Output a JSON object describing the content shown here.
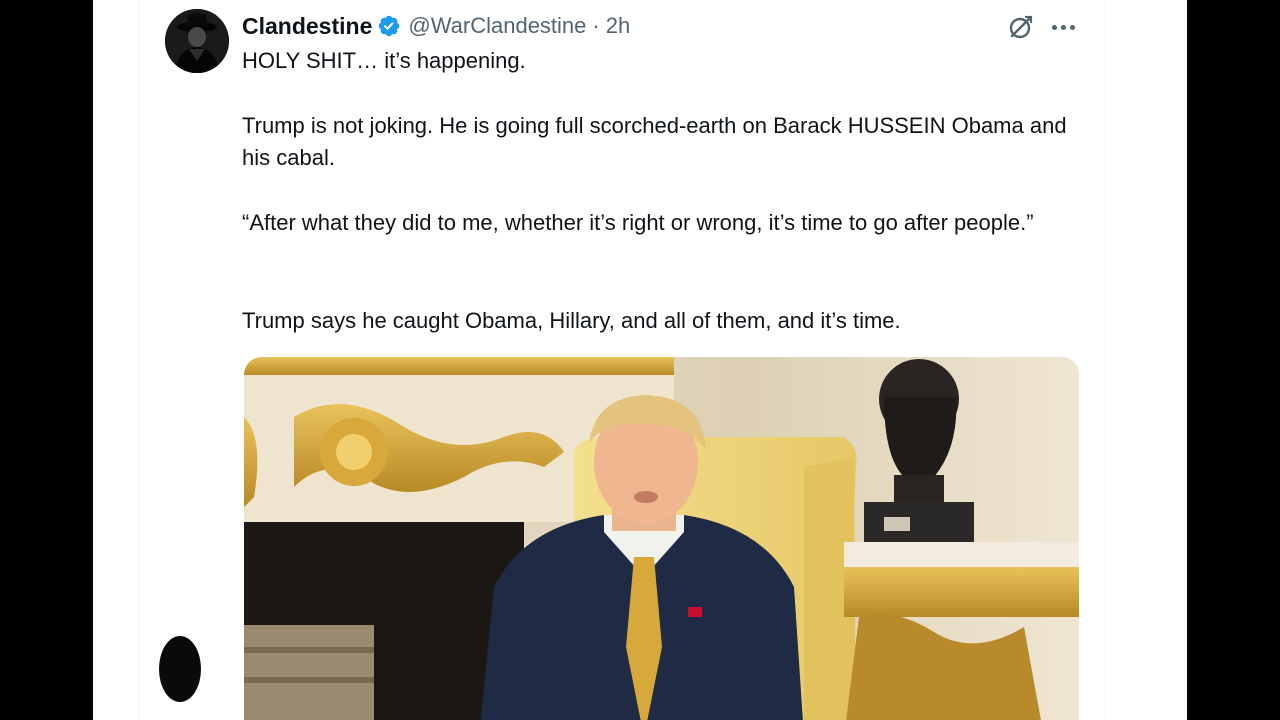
{
  "tweet": {
    "author": {
      "display_name": "Clandestine",
      "handle": "@WarClandestine",
      "verified": true,
      "verified_color": "#1d9bf0"
    },
    "separator": "·",
    "time": "2h",
    "paragraphs": [
      "HOLY SHIT… it’s happening.",
      "Trump is not joking. He is going full scorched-earth on Barack HUSSEIN Obama and his cabal.",
      "“After what they did to me, whether it’s right or wrong, it’s time to go after people.”",
      "Trump says he caught Obama, Hillary, and all of them, and it’s time."
    ],
    "icons": {
      "grok": "grok-icon",
      "more": "more-icon"
    }
  },
  "colors": {
    "text": "#0f1419",
    "secondary": "#536471",
    "background": "#ffffff"
  }
}
